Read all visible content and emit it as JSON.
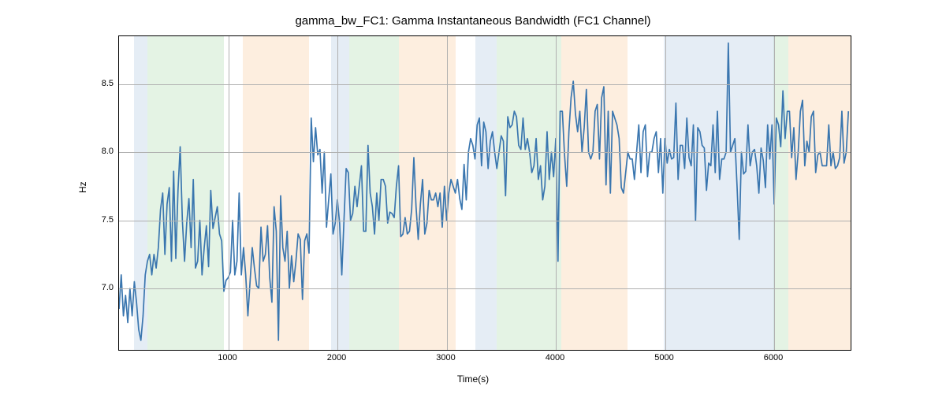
{
  "chart_data": {
    "type": "line",
    "title": "gamma_bw_FC1: Gamma Instantaneous Bandwidth (FC1 Channel)",
    "xlabel": "Time(s)",
    "ylabel": "Hz",
    "xlim": [
      0,
      6700
    ],
    "ylim": [
      6.55,
      8.85
    ],
    "xticks": [
      1000,
      2000,
      3000,
      4000,
      5000,
      6000
    ],
    "yticks": [
      7.0,
      7.5,
      8.0,
      8.5
    ],
    "bands": [
      {
        "start": 140,
        "end": 260,
        "color": "blue"
      },
      {
        "start": 260,
        "end": 960,
        "color": "green"
      },
      {
        "start": 1130,
        "end": 1740,
        "color": "orange"
      },
      {
        "start": 1940,
        "end": 2110,
        "color": "blue"
      },
      {
        "start": 2110,
        "end": 2560,
        "color": "green"
      },
      {
        "start": 2560,
        "end": 3080,
        "color": "orange"
      },
      {
        "start": 3260,
        "end": 3460,
        "color": "blue"
      },
      {
        "start": 3460,
        "end": 4050,
        "color": "green"
      },
      {
        "start": 4050,
        "end": 4660,
        "color": "orange"
      },
      {
        "start": 4990,
        "end": 6000,
        "color": "blue"
      },
      {
        "start": 5990,
        "end": 6130,
        "color": "green"
      },
      {
        "start": 6130,
        "end": 6700,
        "color": "orange"
      }
    ],
    "x": [
      0,
      20,
      40,
      60,
      80,
      100,
      120,
      140,
      160,
      180,
      200,
      220,
      240,
      260,
      280,
      300,
      320,
      340,
      360,
      380,
      400,
      420,
      440,
      460,
      480,
      500,
      520,
      540,
      560,
      580,
      600,
      620,
      640,
      660,
      680,
      700,
      720,
      740,
      760,
      780,
      800,
      820,
      840,
      860,
      880,
      900,
      920,
      940,
      960,
      980,
      1000,
      1020,
      1040,
      1060,
      1080,
      1100,
      1120,
      1140,
      1160,
      1180,
      1200,
      1220,
      1240,
      1260,
      1280,
      1300,
      1320,
      1340,
      1360,
      1380,
      1400,
      1420,
      1440,
      1460,
      1480,
      1500,
      1520,
      1540,
      1560,
      1580,
      1600,
      1620,
      1640,
      1660,
      1680,
      1700,
      1720,
      1740,
      1760,
      1780,
      1800,
      1820,
      1840,
      1860,
      1880,
      1900,
      1920,
      1940,
      1960,
      1980,
      2000,
      2020,
      2040,
      2060,
      2080,
      2100,
      2120,
      2140,
      2160,
      2180,
      2200,
      2220,
      2240,
      2260,
      2280,
      2300,
      2320,
      2340,
      2360,
      2380,
      2400,
      2420,
      2440,
      2460,
      2480,
      2500,
      2520,
      2540,
      2560,
      2580,
      2600,
      2620,
      2640,
      2660,
      2680,
      2700,
      2720,
      2740,
      2760,
      2780,
      2800,
      2820,
      2840,
      2860,
      2880,
      2900,
      2920,
      2940,
      2960,
      2980,
      3000,
      3020,
      3040,
      3060,
      3080,
      3100,
      3120,
      3140,
      3160,
      3180,
      3200,
      3220,
      3240,
      3260,
      3280,
      3300,
      3320,
      3340,
      3360,
      3380,
      3400,
      3420,
      3440,
      3460,
      3480,
      3500,
      3520,
      3540,
      3560,
      3580,
      3600,
      3620,
      3640,
      3660,
      3680,
      3700,
      3720,
      3740,
      3760,
      3780,
      3800,
      3820,
      3840,
      3860,
      3880,
      3900,
      3920,
      3940,
      3960,
      3980,
      4000,
      4020,
      4040,
      4060,
      4080,
      4100,
      4120,
      4140,
      4160,
      4180,
      4200,
      4220,
      4240,
      4260,
      4280,
      4300,
      4320,
      4340,
      4360,
      4380,
      4400,
      4420,
      4440,
      4460,
      4480,
      4500,
      4520,
      4540,
      4560,
      4580,
      4600,
      4620,
      4640,
      4660,
      4680,
      4700,
      4720,
      4740,
      4760,
      4780,
      4800,
      4820,
      4840,
      4860,
      4880,
      4900,
      4920,
      4940,
      4960,
      4980,
      5000,
      5020,
      5040,
      5060,
      5080,
      5100,
      5120,
      5140,
      5160,
      5180,
      5200,
      5220,
      5240,
      5260,
      5280,
      5300,
      5320,
      5340,
      5360,
      5380,
      5400,
      5420,
      5440,
      5460,
      5480,
      5500,
      5520,
      5540,
      5560,
      5580,
      5600,
      5620,
      5640,
      5660,
      5680,
      5700,
      5720,
      5740,
      5760,
      5780,
      5800,
      5820,
      5840,
      5860,
      5880,
      5900,
      5920,
      5940,
      5960,
      5980,
      6000,
      6020,
      6040,
      6060,
      6080,
      6100,
      6120,
      6140,
      6160,
      6180,
      6200,
      6220,
      6240,
      6260,
      6280,
      6300,
      6320,
      6340,
      6360,
      6380,
      6400,
      6420,
      6440,
      6460,
      6480,
      6500,
      6520,
      6540,
      6560,
      6580,
      6600,
      6620,
      6640,
      6660,
      6680
    ],
    "y": [
      6.85,
      7.1,
      6.8,
      6.95,
      6.75,
      7.0,
      6.8,
      7.05,
      6.9,
      6.7,
      6.62,
      6.8,
      7.1,
      7.2,
      7.25,
      7.1,
      7.25,
      7.15,
      7.3,
      7.58,
      7.7,
      7.25,
      7.62,
      7.74,
      7.2,
      7.86,
      7.22,
      7.72,
      8.04,
      7.5,
      7.2,
      7.48,
      7.66,
      7.3,
      7.8,
      7.15,
      7.2,
      7.5,
      7.1,
      7.3,
      7.46,
      7.16,
      7.72,
      7.44,
      7.52,
      7.6,
      7.4,
      7.35,
      6.98,
      7.06,
      7.08,
      7.12,
      7.5,
      7.1,
      7.2,
      7.7,
      7.1,
      7.3,
      7.1,
      6.8,
      7.05,
      7.3,
      7.15,
      7.02,
      7.0,
      7.45,
      7.2,
      7.25,
      7.46,
      7.08,
      6.9,
      7.6,
      7.42,
      6.62,
      7.68,
      7.3,
      7.2,
      7.42,
      7.0,
      7.24,
      7.05,
      7.2,
      7.4,
      7.36,
      6.92,
      7.35,
      7.4,
      7.26,
      8.25,
      7.93,
      8.18,
      7.98,
      8.02,
      7.7,
      8.0,
      7.45,
      7.65,
      7.84,
      7.4,
      7.48,
      7.65,
      7.48,
      7.1,
      7.5,
      7.88,
      7.85,
      7.5,
      7.55,
      7.75,
      7.6,
      7.75,
      7.9,
      7.42,
      7.42,
      8.05,
      7.7,
      7.6,
      7.4,
      7.7,
      7.5,
      7.8,
      7.8,
      7.75,
      7.48,
      7.56,
      7.55,
      7.52,
      7.75,
      7.9,
      7.38,
      7.4,
      7.52,
      7.4,
      7.42,
      7.58,
      7.96,
      7.6,
      7.36,
      7.62,
      7.8,
      7.4,
      7.48,
      7.72,
      7.65,
      7.65,
      7.7,
      7.6,
      7.7,
      7.45,
      7.75,
      7.5,
      7.7,
      7.8,
      7.75,
      7.7,
      7.8,
      7.66,
      7.58,
      7.91,
      7.65,
      8.0,
      8.1,
      8.05,
      7.95,
      8.2,
      8.25,
      7.9,
      8.22,
      8.15,
      7.88,
      8.08,
      8.15,
      8.0,
      7.88,
      8.0,
      8.12,
      8.08,
      7.68,
      8.26,
      8.18,
      8.2,
      8.3,
      8.26,
      8.05,
      8.02,
      8.25,
      8.02,
      8.1,
      8.0,
      7.85,
      7.9,
      8.1,
      7.8,
      7.9,
      7.65,
      7.75,
      8.15,
      7.8,
      8.0,
      7.82,
      8.1,
      7.2,
      8.3,
      8.3,
      7.98,
      7.75,
      8.15,
      8.4,
      8.52,
      8.28,
      8.15,
      8.3,
      8.0,
      8.18,
      8.46,
      8.0,
      7.95,
      8.0,
      8.3,
      8.35,
      7.95,
      8.4,
      8.48,
      7.76,
      8.3,
      7.7,
      8.3,
      8.25,
      8.2,
      8.1,
      7.74,
      7.7,
      7.85,
      8.0,
      7.95,
      7.95,
      7.8,
      8.0,
      8.2,
      7.85,
      8.15,
      8.2,
      7.82,
      8.0,
      8.0,
      8.1,
      8.15,
      7.85,
      8.1,
      7.7,
      8.1,
      7.92,
      8.02,
      7.95,
      7.96,
      8.36,
      7.8,
      8.05,
      8.05,
      7.88,
      8.25,
      7.96,
      7.9,
      8.2,
      7.5,
      8.18,
      8.15,
      8.05,
      8.03,
      7.72,
      7.92,
      7.9,
      8.2,
      7.85,
      8.3,
      7.8,
      7.95,
      7.95,
      8.0,
      8.8,
      8.0,
      8.05,
      8.1,
      7.75,
      7.36,
      8.0,
      7.84,
      7.86,
      8.2,
      7.9,
      8.0,
      8.02,
      7.9,
      7.7,
      8.03,
      7.94,
      7.74,
      8.2,
      7.95,
      8.2,
      7.62,
      8.25,
      8.2,
      8.04,
      8.45,
      8.1,
      8.3,
      8.3,
      7.96,
      8.18,
      7.8,
      8.0,
      8.3,
      8.38,
      7.9,
      8.08,
      8.0,
      8.26,
      8.3,
      7.85,
      7.98,
      8.0,
      7.9,
      7.9,
      7.9,
      8.2,
      7.9,
      8.0,
      7.88,
      7.9,
      7.96,
      8.3,
      7.92,
      8.0,
      8.3
    ]
  }
}
